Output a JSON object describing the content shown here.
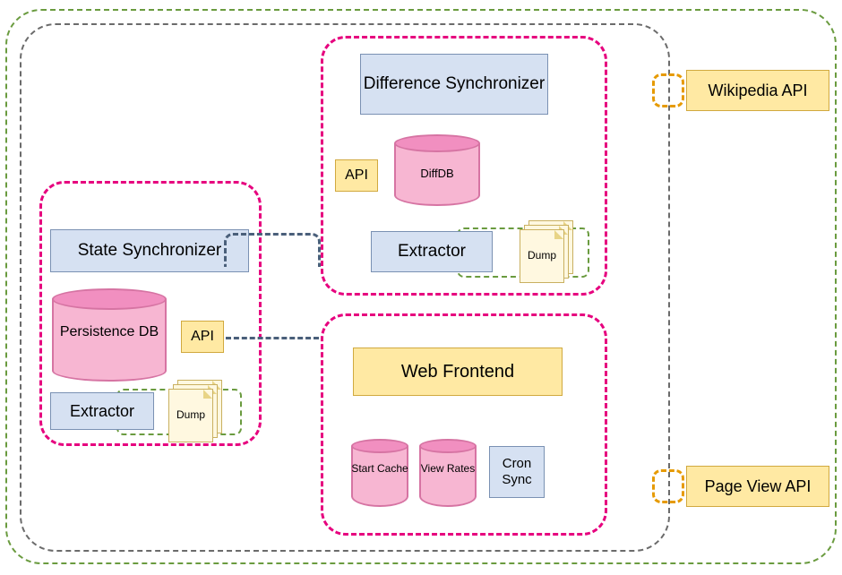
{
  "outer": {},
  "modules": {
    "state_sync": {
      "title": "State Synchronizer",
      "db": "Persistence DB",
      "api": "API",
      "extractor": "Extractor",
      "dump": "Dump"
    },
    "diff_sync": {
      "title": "Difference Synchronizer",
      "api": "API",
      "db": "DiffDB",
      "extractor": "Extractor",
      "dump": "Dump"
    },
    "web_frontend": {
      "title": "Web Frontend",
      "start_cache": "Start Cache",
      "view_rates": "View Rates",
      "cron_sync": "Cron Sync"
    }
  },
  "external": {
    "wikipedia_api": "Wikipedia API",
    "page_view_api": "Page View API"
  }
}
